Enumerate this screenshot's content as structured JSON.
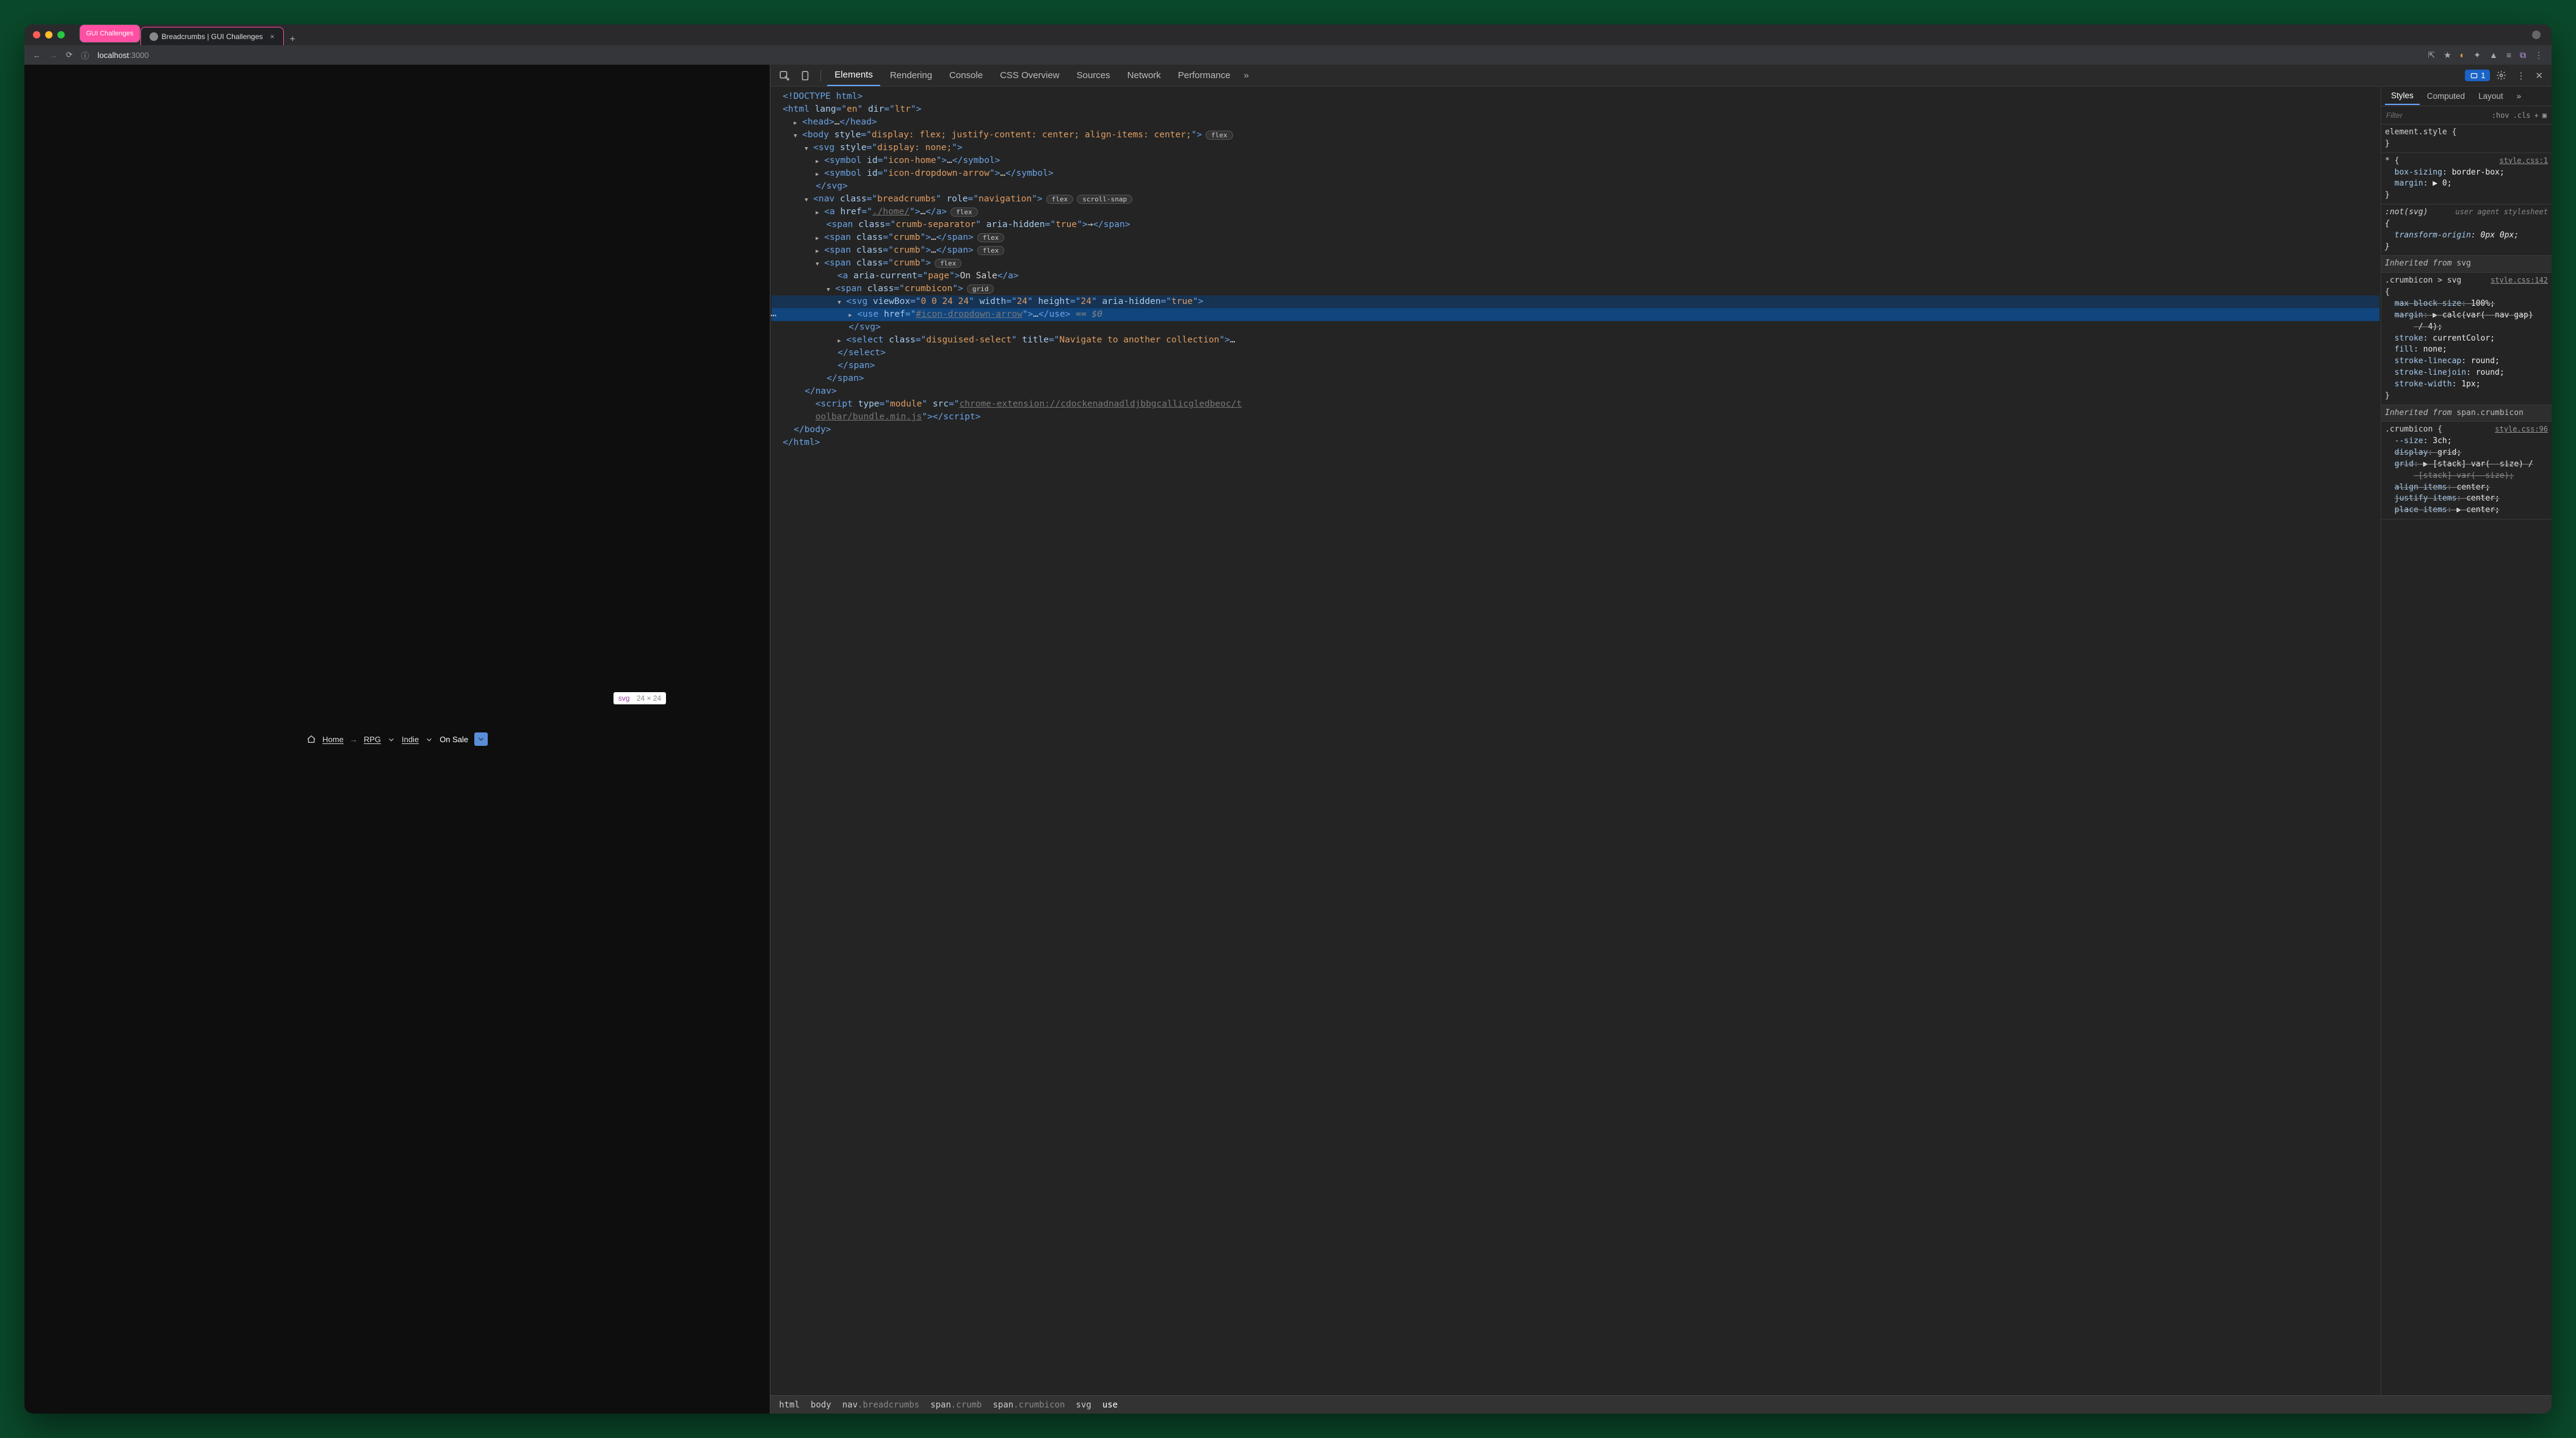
{
  "browser": {
    "tabs": [
      {
        "label": "GUI Challenges",
        "style": "pill"
      },
      {
        "label": "Breadcrumbs | GUI Challenges",
        "style": "active"
      }
    ],
    "url": {
      "scheme": "localhost",
      "port": ":3000"
    }
  },
  "viewport": {
    "tooltip": {
      "tag": "svg",
      "dims": "24 × 24"
    },
    "crumbs": {
      "home": "Home",
      "rpg": "RPG",
      "indie": "Indie",
      "onsale": "On Sale"
    }
  },
  "devtools": {
    "tabs": [
      "Elements",
      "Rendering",
      "Console",
      "CSS Overview",
      "Sources",
      "Network",
      "Performance"
    ],
    "issue_count": "1"
  },
  "elements": {
    "l1": "<!DOCTYPE html>",
    "l2a": "<html ",
    "l2b": "lang",
    "l2c": "=\"",
    "l2d": "en",
    "l2e": "\" ",
    "l2f": "dir",
    "l2g": "=\"",
    "l2h": "ltr",
    "l2i": "\">",
    "l3a": "<head>",
    "l3b": "…",
    "l3c": "</head>",
    "l4a": "<body ",
    "l4b": "style",
    "l4c": "=\"",
    "l4d": "display: flex; justify-content: center; align-items: center;",
    "l4e": "\">",
    "l4p": "flex",
    "l5a": "<svg ",
    "l5b": "style",
    "l5c": "=\"",
    "l5d": "display: none;",
    "l5e": "\">",
    "l6a": "<symbol ",
    "l6b": "id",
    "l6c": "=\"",
    "l6d": "icon-home",
    "l6e": "\">",
    "l6f": "…",
    "l6g": "</symbol>",
    "l7a": "<symbol ",
    "l7b": "id",
    "l7c": "=\"",
    "l7d": "icon-dropdown-arrow",
    "l7e": "\">",
    "l7f": "…",
    "l7g": "</symbol>",
    "l8": "</svg>",
    "l9a": "<nav ",
    "l9b": "class",
    "l9c": "=\"",
    "l9d": "breadcrumbs",
    "l9e": "\" ",
    "l9f": "role",
    "l9g": "=\"",
    "l9h": "navigation",
    "l9i": "\">",
    "l9p1": "flex",
    "l9p2": "scroll-snap",
    "l10a": "<a ",
    "l10b": "href",
    "l10c": "=\"",
    "l10d": "./home/",
    "l10e": "\">",
    "l10f": "…",
    "l10g": "</a>",
    "l10p": "flex",
    "l11a": "<span ",
    "l11b": "class",
    "l11c": "=\"",
    "l11d": "crumb-separator",
    "l11e": "\" ",
    "l11f": "aria-hidden",
    "l11g": "=\"",
    "l11h": "true",
    "l11i": "\">",
    "l11j": "→",
    "l11k": "</span>",
    "l12a": "<span ",
    "l12b": "class",
    "l12c": "=\"",
    "l12d": "crumb",
    "l12e": "\">",
    "l12f": "…",
    "l12g": "</span>",
    "l12p": "flex",
    "l13a": "<span ",
    "l13b": "class",
    "l13c": "=\"",
    "l13d": "crumb",
    "l13e": "\">",
    "l13f": "…",
    "l13g": "</span>",
    "l13p": "flex",
    "l14a": "<span ",
    "l14b": "class",
    "l14c": "=\"",
    "l14d": "crumb",
    "l14e": "\">",
    "l14p": "flex",
    "l15a": "<a ",
    "l15b": "aria-current",
    "l15c": "=\"",
    "l15d": "page",
    "l15e": "\">",
    "l15f": "On Sale",
    "l15g": "</a>",
    "l16a": "<span ",
    "l16b": "class",
    "l16c": "=\"",
    "l16d": "crumbicon",
    "l16e": "\">",
    "l16p": "grid",
    "l17a": "<svg ",
    "l17b": "viewBox",
    "l17c": "=\"",
    "l17d": "0 0 24 24",
    "l17e": "\" ",
    "l17f": "width",
    "l17g": "=\"",
    "l17h": "24",
    "l17i": "\" ",
    "l17j": "height",
    "l17k": "=\"",
    "l17l": "24",
    "l17m": "\" ",
    "l17n": "aria-hidden",
    "l17o": "=\"",
    "l17p": "true",
    "l17q": "\">",
    "l18a": "<use ",
    "l18b": "href",
    "l18c": "=\"",
    "l18d": "#icon-dropdown-arrow",
    "l18e": "\">",
    "l18f": "…",
    "l18g": "</use>",
    "l18h": " == ",
    "l18i": "$0",
    "l19": "</svg>",
    "l20a": "<select ",
    "l20b": "class",
    "l20c": "=\"",
    "l20d": "disguised-select",
    "l20e": "\" ",
    "l20f": "title",
    "l20g": "=\"",
    "l20h": "Navigate to another collection",
    "l20i": "\">",
    "l20j": "…",
    "l21": "</select>",
    "l22": "</span>",
    "l23": "</span>",
    "l24": "</nav>",
    "l25a": "<script ",
    "l25b": "type",
    "l25c": "=\"",
    "l25d": "module",
    "l25e": "\" ",
    "l25f": "src",
    "l25g": "=\"",
    "l25h": "chrome-extension://cdockenadnadldjbbgcallicgledbeoc/t",
    "l25i": "oolbar/bundle.min.js",
    "l25j": "\">",
    "l25k": "</script>",
    "l26": "</body>",
    "l27": "</html>"
  },
  "styles_tabs": [
    "Styles",
    "Computed",
    "Layout"
  ],
  "filter_placeholder": "Filter",
  "filter_btns": [
    ":hov",
    ".cls",
    "+"
  ],
  "rules": {
    "r1": {
      "sel": "element.style {",
      "close": "}"
    },
    "r2": {
      "sel": "* {",
      "src": "style.css:1",
      "p1k": "box-sizing",
      "p1v": "border-box;",
      "p2k": "margin",
      "p2v": "▶ 0;",
      "close": "}"
    },
    "r3": {
      "sel": ":not(svg)",
      "ua": "user agent stylesheet",
      "open": "{",
      "p1k": "transform-origin",
      "p1v": "0px 0px;",
      "close": "}"
    },
    "inh1": "Inherited from ",
    "inh1kw": "svg",
    "r4": {
      "sel": ".crumbicon > svg",
      "src": "style.css:142",
      "open": "{",
      "p1k": "max-block-size",
      "p1v": "100%;",
      "p2k": "margin",
      "p2v": "▶ calc(var(--nav-gap)",
      "p2v2": "  / 4);",
      "p3k": "stroke",
      "p3v": "currentColor;",
      "p4k": "fill",
      "p4v": "none;",
      "p5k": "stroke-linecap",
      "p5v": "round;",
      "p6k": "stroke-linejoin",
      "p6v": "round;",
      "p7k": "stroke-width",
      "p7v": "1px;",
      "close": "}"
    },
    "inh2": "Inherited from ",
    "inh2kw": "span.crumbicon",
    "r5": {
      "sel": ".crumbicon {",
      "src": "style.css:96",
      "p1k": "--size",
      "p1v": "3ch;",
      "p2k": "display",
      "p2v": "grid;",
      "p3k": "grid",
      "p3v": "▶ [stack] var(--size) /",
      "p3v2": "  [stack] var(--size);",
      "p4k": "align-items",
      "p4v": "center;",
      "p5k": "justify-items",
      "p5v": "center;",
      "p6k": "place-items",
      "p6v": "▶ center;"
    }
  },
  "crumbtrail": [
    "html",
    "body",
    "nav",
    "breadcrumbs",
    "span",
    "crumb",
    "span",
    "crumbicon",
    "svg",
    "use"
  ]
}
